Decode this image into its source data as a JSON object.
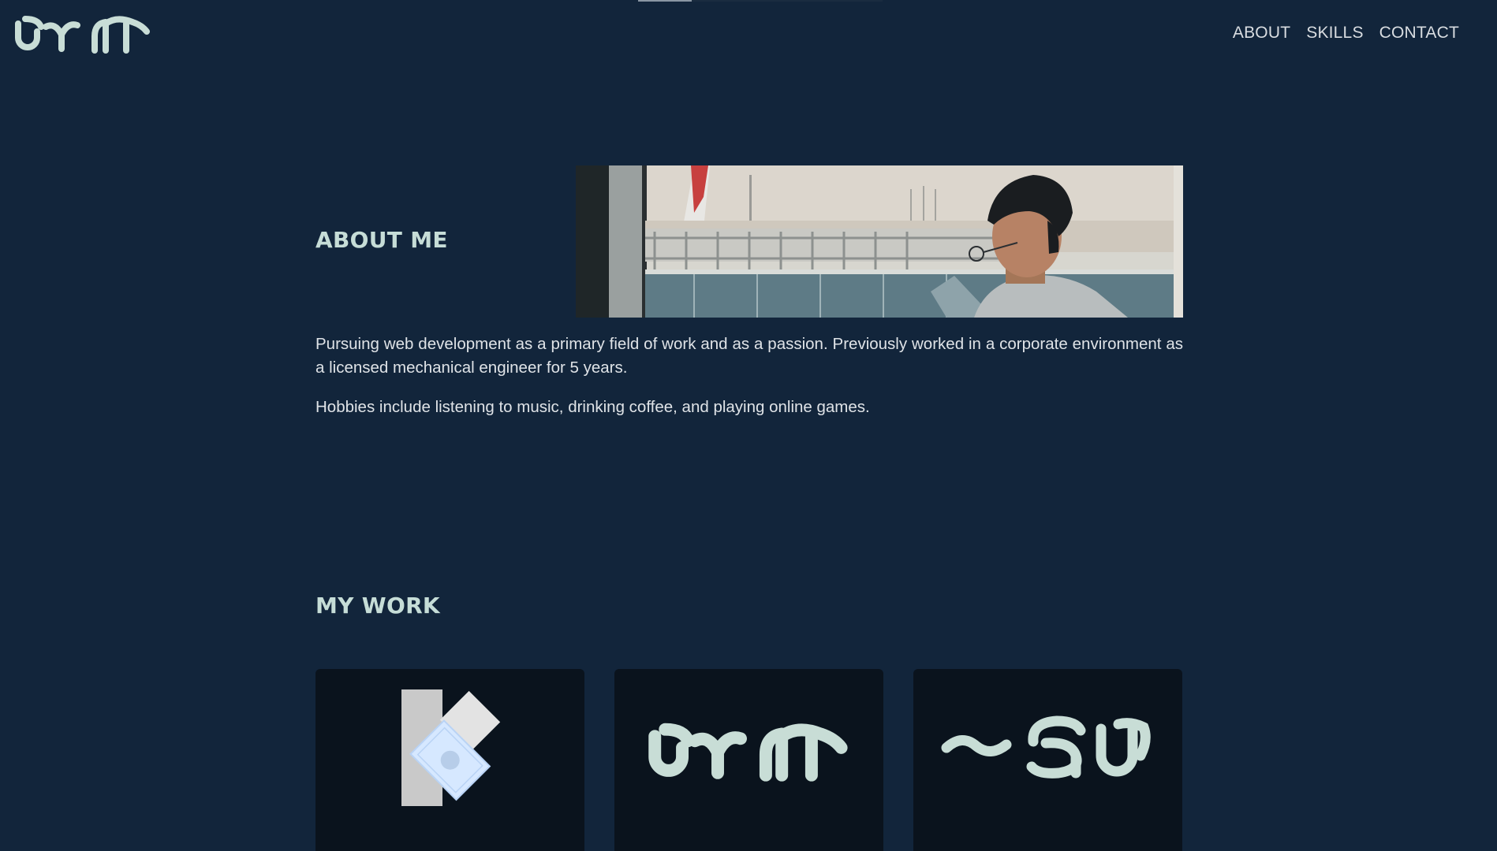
{
  "header": {
    "logo_icon": "glyph-logo-icon",
    "nav": [
      {
        "label": "ABOUT"
      },
      {
        "label": "SKILLS"
      },
      {
        "label": "CONTACT"
      }
    ]
  },
  "scroll_progress": 0.22,
  "about": {
    "title": "ABOUT ME",
    "paragraphs": [
      "Pursuing web development as a primary field of work and as a passion. Previously worked in a corporate environment as a licensed mechanical engineer for 5 years.",
      "Hobbies include listening to music, drinking coffee, and playing online games."
    ]
  },
  "work": {
    "title": "MY WORK",
    "cards": [
      {
        "icon": "k-card-logo-icon"
      },
      {
        "icon": "glyph-logo-icon"
      },
      {
        "icon": "glyph-wave-logo-icon"
      }
    ]
  },
  "colors": {
    "background": "#12253b",
    "heading": "#c6ddd7",
    "text": "#dfe3e7",
    "card": "#0a131d",
    "logo": "#c8ddd6"
  }
}
